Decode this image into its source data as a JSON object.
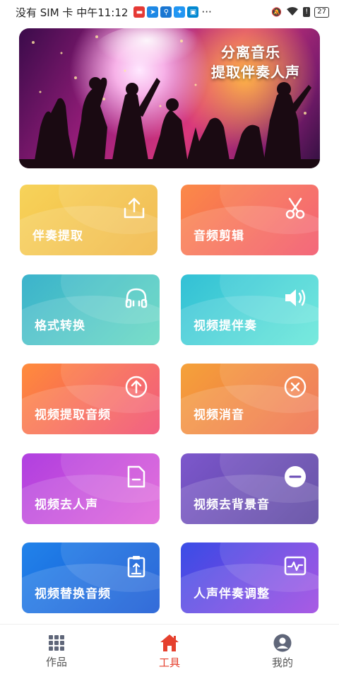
{
  "status_bar": {
    "carrier_text": "没有 SIM 卡 中午11:12",
    "dots": "···",
    "battery": "27"
  },
  "banner": {
    "line1": "分离音乐",
    "line2": "提取伴奏人声"
  },
  "tools": [
    {
      "label": "伴奏提取",
      "icon": "upload-icon"
    },
    {
      "label": "音频剪辑",
      "icon": "scissors-icon"
    },
    {
      "label": "格式转换",
      "icon": "headphones-icon"
    },
    {
      "label": "视频提伴奏",
      "icon": "speaker-icon"
    },
    {
      "label": "视频提取音频",
      "icon": "arrow-up-circle-icon"
    },
    {
      "label": "视频消音",
      "icon": "close-circle-icon"
    },
    {
      "label": "视频去人声",
      "icon": "document-minus-icon"
    },
    {
      "label": "视频去背景音",
      "icon": "minus-circle-icon"
    },
    {
      "label": "视频替换音频",
      "icon": "clipboard-upload-icon"
    },
    {
      "label": "人声伴奏调整",
      "icon": "waveform-icon"
    }
  ],
  "colors": {
    "accent": "#e5402e",
    "card_gradients": [
      [
        "#f6d04d",
        "#f0b83c"
      ],
      [
        "#f97a4a",
        "#f25266"
      ],
      [
        "#39b7c9",
        "#5fd6c2"
      ],
      [
        "#34c3d6",
        "#5fe6d6"
      ],
      [
        "#ff8a3d",
        "#f14b6c"
      ],
      [
        "#f6a13c",
        "#ef6a4a"
      ],
      [
        "#b43de0",
        "#e25ed6"
      ],
      [
        "#7a56c9",
        "#5a3f9e"
      ],
      [
        "#1f7ee8",
        "#1356d4"
      ],
      [
        "#3d4fe6",
        "#9a3fe0"
      ]
    ]
  },
  "nav": {
    "works": "作品",
    "tools": "工具",
    "mine": "我的"
  }
}
